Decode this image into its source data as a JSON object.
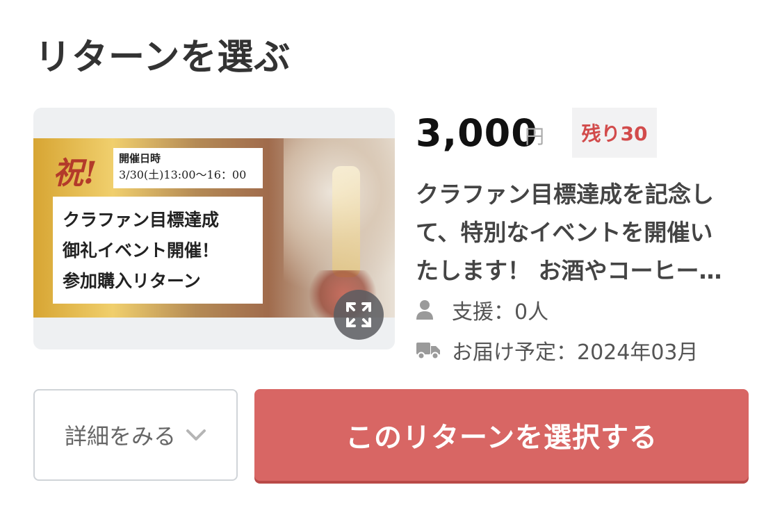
{
  "section": {
    "title": "リターンを選ぶ"
  },
  "thumbnail": {
    "celebrate": "祝!",
    "date_label": "開催日時",
    "date_value": "3/30(土)13:00〜16：00",
    "main_lines": [
      "クラファン目標達成",
      "御礼イベント開催！",
      "参加購入リターン"
    ],
    "expand_icon": "expand-icon"
  },
  "reward": {
    "price": "3,000",
    "unit": "円",
    "stock": "残り30",
    "description_lines": [
      "クラファン目標達成を記念し",
      "て、特別なイベントを開催い",
      "たします！ お酒やコーヒー…"
    ],
    "supporters": "支援：0人",
    "delivery": "お届け予定：2024年03月",
    "supporters_icon": "person-icon",
    "delivery_icon": "truck-icon"
  },
  "buttons": {
    "details": "詳細をみる",
    "select": "このリターンを選択する"
  },
  "colors": {
    "accent": "#d86664",
    "stock_text": "#d24b4b",
    "badge_bg": "#f2f2f3"
  }
}
